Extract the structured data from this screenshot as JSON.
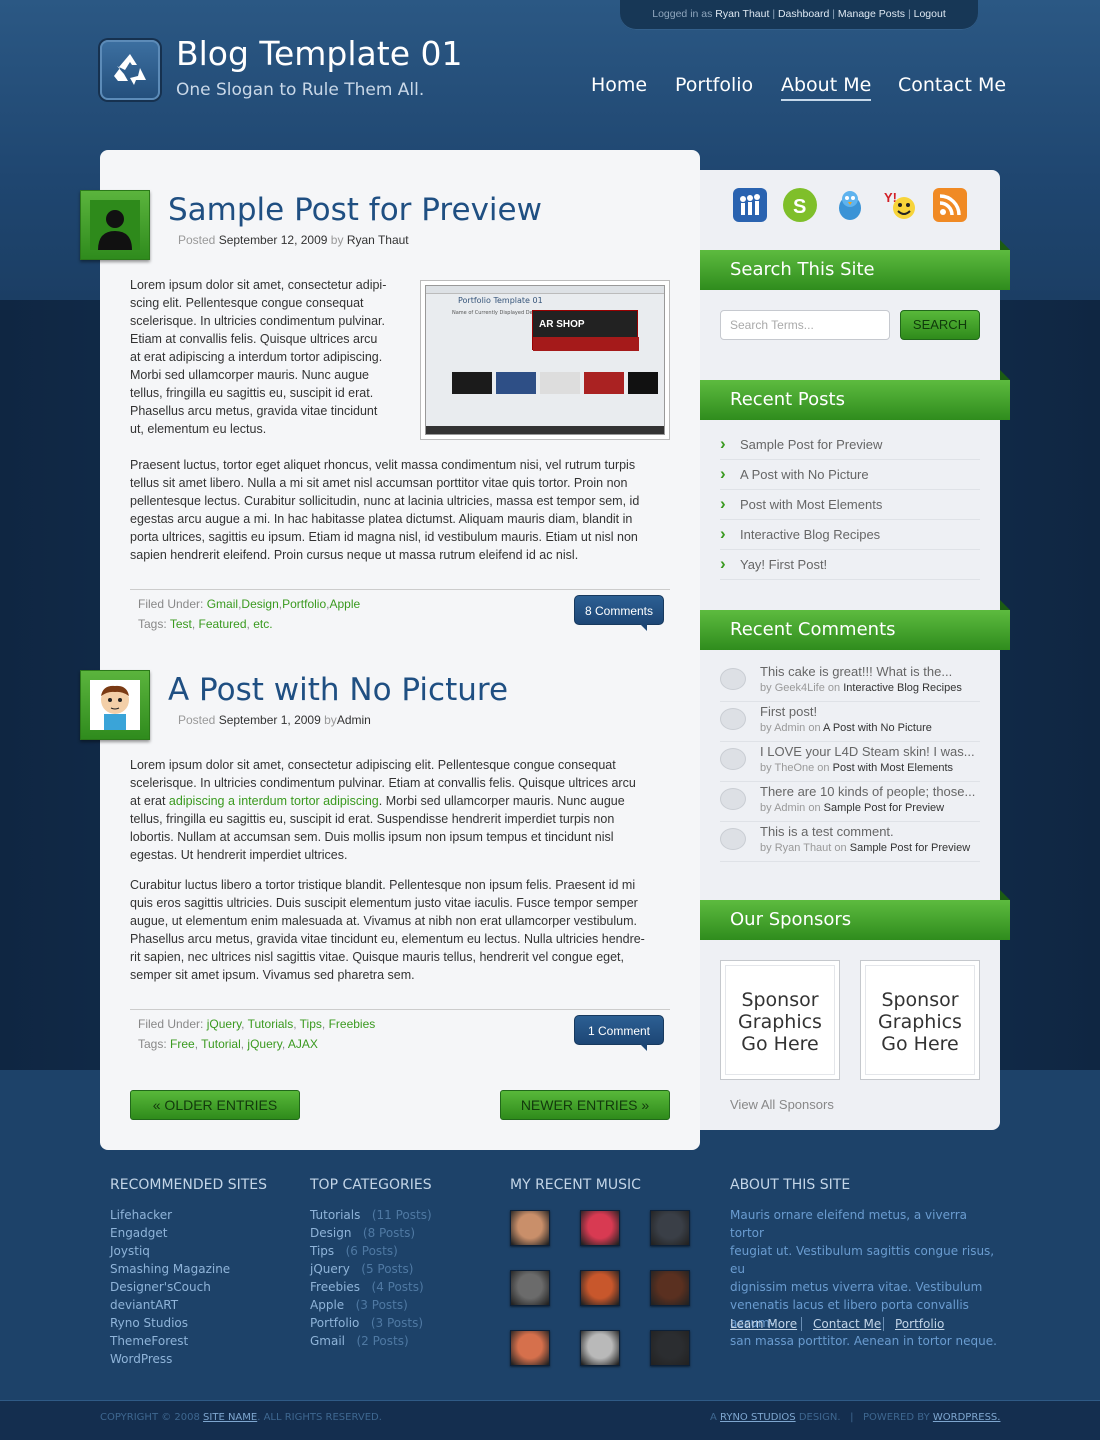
{
  "topbar": {
    "prefix": "Logged in as",
    "user": "Ryan Thaut",
    "links": [
      "Dashboard",
      "Manage Posts",
      "Logout"
    ],
    "sep": "|"
  },
  "site": {
    "title": "Blog Template 01",
    "slogan": "One Slogan to Rule Them All.",
    "logo_icon": "recycle-icon"
  },
  "nav": [
    {
      "label": "Home"
    },
    {
      "label": "Portfolio"
    },
    {
      "label": "About Me",
      "active": true
    },
    {
      "label": "Contact Me"
    }
  ],
  "posts": [
    {
      "title": "Sample Post for Preview",
      "posted_label": "Posted",
      "date": "September 12, 2009",
      "by_label": "by",
      "author": "Ryan Thaut",
      "para1": [
        "Lorem ipsum dolor sit amet, consectetur adipi-",
        "scing elit. Pellentesque congue consequat",
        "scelerisque. In ultricies condimentum pulvinar.",
        "Etiam at convallis felis. Quisque ultrices arcu",
        "at erat adipiscing a interdum tortor adipiscing.",
        "Morbi sed ullamcorper mauris. Nunc augue",
        "tellus, fringilla eu sagittis eu, suscipit id erat.",
        "Phasellus arcu metus, gravida vitae tincidunt",
        "ut, elementum eu lectus."
      ],
      "para2": [
        "Praesent luctus, tortor eget aliquet rhoncus, velit massa condimentum nisi, vel rutrum turpis",
        "tellus sit amet libero. Nulla a mi sit amet nisl accumsan porttitor vitae quis tortor. Proin non",
        "pellentesque lectus. Curabitur sollicitudin, nunc at lacinia ultricies, massa est tempor sem, id",
        "egestas arcu augue a mi. In hac habitasse platea dictumst. Aliquam mauris diam, blandit in",
        "porta ultrices, sagittis eu ipsum. Etiam id magna nisl, id vestibulum mauris. Etiam ut nisl non",
        "sapien hendrerit eleifend. Proin cursus neque ut massa rutrum eleifend id ac nisl."
      ],
      "filed_label": "Filed Under:",
      "filed": [
        "Gmail",
        "Design",
        "Portfolio",
        "Apple"
      ],
      "tags_label": "Tags:",
      "tags": [
        "Test",
        "Featured",
        "etc."
      ],
      "comments": "8 Comments",
      "screenshot": {
        "title": "Portfolio Template 01",
        "banner": "AR SHOP",
        "caption": "Name of Currently Displayed Design"
      }
    },
    {
      "title": "A Post with No Picture",
      "posted_label": "Posted",
      "date": "September 1, 2009",
      "by_label": "by",
      "author": "Admin",
      "para1": [
        "Lorem ipsum dolor sit amet, consectetur adipiscing elit. Pellentesque congue consequat",
        "scelerisque. In ultricies condimentum pulvinar. Etiam at convallis felis. Quisque ultrices arcu"
      ],
      "para1_line3_pre": "at erat ",
      "para1_link": "adipiscing a interdum tortor adipiscing",
      "para1_line3_post": ". Morbi sed ullamcorper mauris. Nunc augue",
      "para1_rest": [
        "tellus, fringilla eu sagittis eu, suscipit id erat. Suspendisse hendrerit imperdiet turpis non",
        "lobortis. Nullam at accumsan sem. Duis mollis ipsum non ipsum tempus et tincidunt nisl",
        "egestas. Ut hendrerit imperdiet ultrices."
      ],
      "para2": [
        "Curabitur luctus libero a tortor tristique blandit. Pellentesque non ipsum felis. Praesent id mi",
        "quis eros sagittis ultricies. Duis suscipit elementum justo vitae iaculis. Fusce tempor semper",
        "augue, ut elementum enim malesuada at. Vivamus at nibh non erat ullamcorper vestibulum.",
        "Phasellus arcu metus, gravida vitae tincidunt eu, elementum eu lectus. Nulla ultricies hendre-",
        "rit sapien, nec ultrices nisl sagittis vitae. Quisque mauris tellus, hendrerit vel congue eget,",
        "semper sit amet ipsum. Vivamus sed pharetra sem."
      ],
      "filed_label": "Filed Under:",
      "filed": [
        "jQuery",
        "Tutorials",
        "Tips",
        "Freebies"
      ],
      "tags_label": "Tags:",
      "tags": [
        "Free",
        "Tutorial",
        "jQuery",
        "AJAX"
      ],
      "comments": "1 Comment"
    }
  ],
  "pager": {
    "older": "« OLDER ENTRIES",
    "newer": "NEWER ENTRIES »"
  },
  "social": [
    "myspace-icon",
    "skype-icon",
    "twitter-icon",
    "yahoo-messenger-icon",
    "rss-icon"
  ],
  "search": {
    "heading": "Search This Site",
    "placeholder": "Search Terms...",
    "button": "SEARCH"
  },
  "recent_posts": {
    "heading": "Recent Posts",
    "items": [
      "Sample Post for Preview",
      "A Post with No Picture",
      "Post with Most Elements",
      "Interactive Blog Recipes",
      "Yay! First Post!"
    ]
  },
  "recent_comments": {
    "heading": "Recent Comments",
    "by": "by",
    "on": "on",
    "items": [
      {
        "text": "This cake is great!!! What is the...",
        "author": "Geek4Life",
        "post": "Interactive Blog Recipes"
      },
      {
        "text": "First post!",
        "author": "Admin",
        "post": "A Post with No Picture"
      },
      {
        "text": "I LOVE your L4D Steam skin! I was...",
        "author": "TheOne",
        "post": "Post with Most Elements"
      },
      {
        "text": "There are 10 kinds of people; those...",
        "author": "Admin",
        "post": "Sample Post for Preview"
      },
      {
        "text": "This is a test comment.",
        "author": "Ryan Thaut",
        "post": "Sample Post for Preview"
      }
    ]
  },
  "sponsors": {
    "heading": "Our Sponsors",
    "box": [
      "Sponsor",
      "Graphics",
      "Go Here"
    ],
    "view_all": "View All Sponsors"
  },
  "footer": {
    "recommended": {
      "heading": "RECOMMENDED SITES",
      "items": [
        "Lifehacker",
        "Engadget",
        "Joystiq",
        "Smashing Magazine",
        "Designer'sCouch",
        "deviantART",
        "Ryno Studios",
        "ThemeForest",
        "WordPress"
      ]
    },
    "categories": {
      "heading": "TOP CATEGORIES",
      "items": [
        {
          "name": "Tutorials",
          "count": "(11 Posts)"
        },
        {
          "name": "Design",
          "count": "(8 Posts)"
        },
        {
          "name": "Tips",
          "count": "(6 Posts)"
        },
        {
          "name": "jQuery",
          "count": "(5 Posts)"
        },
        {
          "name": "Freebies",
          "count": "(4 Posts)"
        },
        {
          "name": "Apple",
          "count": "(3 Posts)"
        },
        {
          "name": "Portfolio",
          "count": "(3 Posts)"
        },
        {
          "name": "Gmail",
          "count": "(2 Posts)"
        }
      ]
    },
    "music": {
      "heading": "MY RECENT MUSIC",
      "colors": [
        "#c98f6a",
        "#d83a52",
        "#3a3f47",
        "#6b6b6b",
        "#c8572c",
        "#5a3020",
        "#d6704c",
        "#b9b9b9",
        "#2b2d30"
      ]
    },
    "about": {
      "heading": "ABOUT THIS SITE",
      "lines": [
        "Mauris ornare eleifend metus, a viverra tortor",
        "feugiat ut. Vestibulum sagittis congue risus, eu",
        "dignissim metus viverra vitae. Vestibulum",
        "venenatis lacus et libero porta convallis accum-",
        "san massa porttitor. Aenean in tortor neque."
      ],
      "links": [
        "Learn More",
        "Contact Me",
        "Portfolio"
      ]
    }
  },
  "copyright": {
    "pre": "COPYRIGHT © 2008",
    "site": "SITE NAME",
    "post": ". ALL RIGHTS RESERVED.",
    "design_pre": "A",
    "design": "RYNO STUDIOS",
    "design_post": "DESIGN.",
    "powered_pre": "POWERED BY",
    "powered": "WORDPRESS."
  }
}
